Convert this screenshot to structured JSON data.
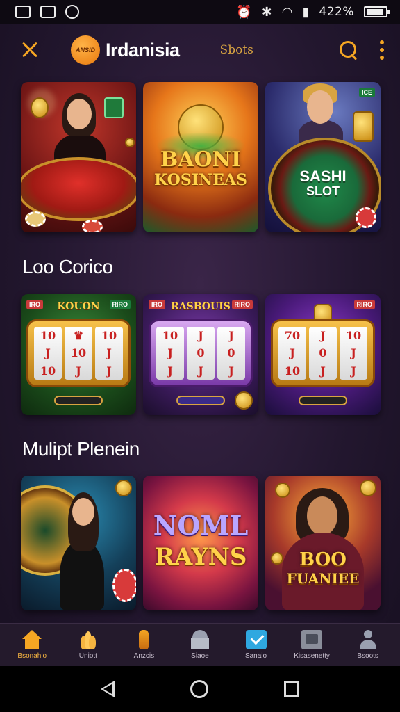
{
  "status_bar": {
    "battery_text": "422%",
    "battery_level": 0.8
  },
  "header": {
    "logo_text": "ANSID",
    "app_title": "Irdanisia",
    "link_label": "Sbots"
  },
  "featured": {
    "cards": [
      {
        "title": "",
        "scene": "dealer"
      },
      {
        "title_line1": "BAONI",
        "title_line2": "KOSINEAS"
      },
      {
        "title_line1": "SASHI",
        "title_line2": "SLOT",
        "scene": "roulette"
      }
    ]
  },
  "sections": [
    {
      "title": "Loo Corico",
      "cards": [
        {
          "header": "KOUON",
          "badge_left": "IRO",
          "badge_right": "RIRO",
          "reels": [
            "10",
            "J",
            "10",
            "♛",
            "10",
            "J",
            "10",
            "J",
            "J"
          ]
        },
        {
          "header": "RASBOUIS",
          "badge_left": "IRO",
          "badge_right": "RIRO",
          "reels": [
            "10",
            "J",
            "J",
            "J",
            "0",
            "J",
            "J",
            "0",
            "J"
          ]
        },
        {
          "header": "",
          "badge_left": "",
          "badge_right": "RIRO",
          "reels": [
            "70",
            "J",
            "10",
            "J",
            "0",
            "J",
            "10",
            "J",
            "J"
          ]
        }
      ]
    },
    {
      "title": "Mulipt Plenein",
      "cards": [
        {
          "title": "",
          "scene": "dealer-roulette"
        },
        {
          "title_line1": "NOML",
          "title_line2": "RAYNS"
        },
        {
          "title_line1": "BOO",
          "title_line2": "FUANIEE",
          "scene": "player"
        }
      ]
    }
  ],
  "bottom_nav": {
    "items": [
      {
        "label": "Bsonahio",
        "icon": "home-icon",
        "active": true
      },
      {
        "label": "Uniott",
        "icon": "lotus-icon",
        "active": false
      },
      {
        "label": "Anzcis",
        "icon": "bottle-icon",
        "active": false
      },
      {
        "label": "Siaoe",
        "icon": "temple-icon",
        "active": false
      },
      {
        "label": "Sanaio",
        "icon": "check-icon",
        "active": false
      },
      {
        "label": "Kisasenetty",
        "icon": "folder-icon",
        "active": false
      },
      {
        "label": "Bsoots",
        "icon": "user-icon",
        "active": false
      }
    ]
  },
  "colors": {
    "accent": "#f5a623",
    "background": "#23172f",
    "nav_background": "#241a2c"
  }
}
